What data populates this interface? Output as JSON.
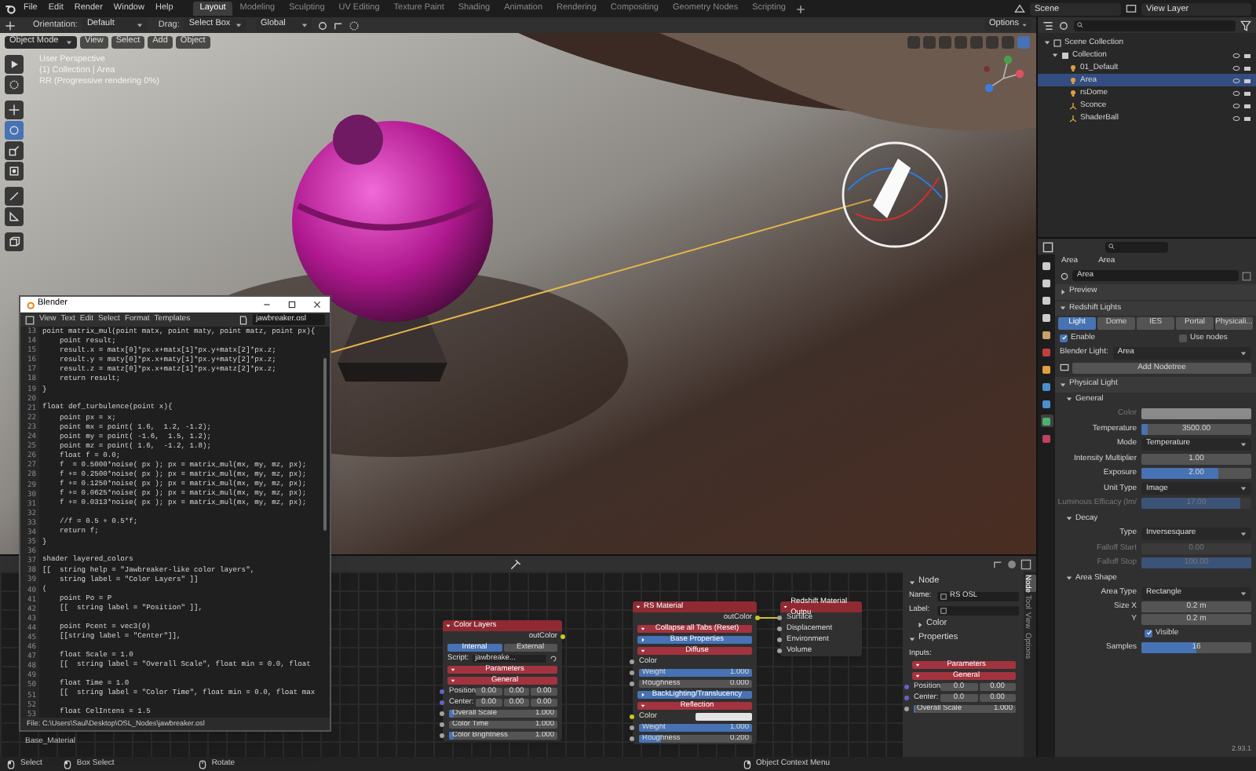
{
  "menubar": {
    "menus": [
      "File",
      "Edit",
      "Render",
      "Window",
      "Help"
    ],
    "workspaces": [
      {
        "label": "Layout",
        "selected": true
      },
      {
        "label": "Modeling",
        "selected": false
      },
      {
        "label": "Sculpting",
        "selected": false
      },
      {
        "label": "UV Editing",
        "selected": false
      },
      {
        "label": "Texture Paint",
        "selected": false
      },
      {
        "label": "Shading",
        "selected": false
      },
      {
        "label": "Animation",
        "selected": false
      },
      {
        "label": "Rendering",
        "selected": false
      },
      {
        "label": "Compositing",
        "selected": false
      },
      {
        "label": "Geometry Nodes",
        "selected": false
      },
      {
        "label": "Scripting",
        "selected": false
      }
    ],
    "scene": "Scene",
    "view_layer": "View Layer"
  },
  "tool_header": {
    "orientation_label": "Orientation:",
    "orientation": "Default",
    "drag_label": "Drag:",
    "drag": "Select Box",
    "transform": "Global",
    "options": "Options"
  },
  "viewport": {
    "mode": "Object Mode",
    "menus": [
      "View",
      "Select",
      "Add",
      "Object"
    ],
    "overlay_lines": [
      "User Perspective",
      "(1) Collection | Area",
      "RR (Progressive rendering 0%)"
    ],
    "tools": [
      {
        "kind": "select",
        "selected": false
      },
      {
        "kind": "cursor",
        "selected": false
      },
      {
        "kind": "move",
        "selected": false
      },
      {
        "kind": "rotate",
        "selected": true
      },
      {
        "kind": "scale",
        "selected": false
      },
      {
        "kind": "transform",
        "selected": false
      },
      {
        "kind": "annotate",
        "selected": false
      },
      {
        "kind": "measure",
        "selected": false
      },
      {
        "kind": "add-cube",
        "selected": false
      }
    ]
  },
  "text_editor": {
    "title": "Blender",
    "menus": [
      "View",
      "Text",
      "Edit",
      "Select",
      "Format",
      "Templates"
    ],
    "file": "jawbreaker.osl",
    "lines": [
      {
        "number": "13",
        "code": "point matrix_mul(point matx, point maty, point matz, point px){"
      },
      {
        "number": "14",
        "code": "    point result;"
      },
      {
        "number": "15",
        "code": "    result.x = matx[0]*px.x+matx[1]*px.y+matx[2]*px.z;"
      },
      {
        "number": "16",
        "code": "    result.y = maty[0]*px.x+maty[1]*px.y+maty[2]*px.z;"
      },
      {
        "number": "17",
        "code": "    result.z = matz[0]*px.x+matz[1]*px.y+matz[2]*px.z;"
      },
      {
        "number": "18",
        "code": "    return result;"
      },
      {
        "number": "19",
        "code": "}"
      },
      {
        "number": "20"
      },
      {
        "number": "21",
        "code": "float def_turbulence(point x){"
      },
      {
        "number": "22",
        "code": "    point px = x;"
      },
      {
        "number": "23",
        "code": "    point mx = point( 1.6,  1.2, -1.2);"
      },
      {
        "number": "24",
        "code": "    point my = point( -1.6,  1.5, 1.2);"
      },
      {
        "number": "25",
        "code": "    point mz = point( 1.6,  -1.2, 1.8);"
      },
      {
        "number": "26",
        "code": "    float f = 0.0;"
      },
      {
        "number": "27",
        "code": "    f  = 0.5000*noise( px ); px = matrix_mul(mx, my, mz, px);"
      },
      {
        "number": "28",
        "code": "    f += 0.2500*noise( px ); px = matrix_mul(mx, my, mz, px);"
      },
      {
        "number": "29",
        "code": "    f += 0.1250*noise( px ); px = matrix_mul(mx, my, mz, px);"
      },
      {
        "number": "30",
        "code": "    f += 0.0625*noise( px ); px = matrix_mul(mx, my, mz, px);"
      },
      {
        "number": "31",
        "code": "    f += 0.0313*noise( px ); px = matrix_mul(mx, my, mz, px);"
      },
      {
        "number": "32"
      },
      {
        "number": "33",
        "code": "    //f = 0.5 + 0.5*f;"
      },
      {
        "number": "34",
        "code": "    return f;"
      },
      {
        "number": "35",
        "code": "}"
      },
      {
        "number": "36"
      },
      {
        "number": "37",
        "code": "shader layered_colors"
      },
      {
        "number": "38",
        "code": "[[  string help = \"Jawbreaker-like color layers\","
      },
      {
        "number": "39",
        "code": "    string label = \"Color Layers\" ]]"
      },
      {
        "number": "40",
        "code": "("
      },
      {
        "number": "41",
        "code": "    point Po = P"
      },
      {
        "number": "42",
        "code": "    [[  string label = \"Position\" ]],"
      },
      {
        "number": "43"
      },
      {
        "number": "44",
        "code": "    point Pcent = vec3(0)"
      },
      {
        "number": "45",
        "code": "    [[string label = \"Center\"]],"
      },
      {
        "number": "46"
      },
      {
        "number": "47",
        "code": "    float Scale = 1.0"
      },
      {
        "number": "48",
        "code": "    [[  string label = \"Overall Scale\", float min = 0.0, float"
      },
      {
        "number": "49"
      },
      {
        "number": "50",
        "code": "    float Time = 1.0"
      },
      {
        "number": "51",
        "code": "    [[  string label = \"Color Time\", float min = 0.0, float max"
      },
      {
        "number": "52"
      },
      {
        "number": "53",
        "code": "    float CelIntens = 1.5"
      }
    ],
    "footer": "File: C:\\Users\\Saul\\Desktop\\OSL_Nodes\\jawbreaker.osl"
  },
  "node_editor": {
    "material": "Base_Material",
    "nodes": [
      {
        "title": "Color Layers",
        "rows": [
          {
            "kind": "output",
            "label": "outColor"
          },
          {
            "kind": "tabs",
            "tabs": [
              {
                "label": "Internal",
                "selected": true
              },
              {
                "label": "External",
                "selected": false
              }
            ]
          },
          {
            "kind": "script",
            "label": "Script:",
            "value": "jawbreake..."
          },
          {
            "kind": "panel",
            "label": "Parameters",
            "expanded": true
          },
          {
            "kind": "panel",
            "label": "General",
            "expanded": true
          },
          {
            "kind": "vector",
            "label": "Position:",
            "values": [
              "0.00",
              "0.00",
              "0.00"
            ]
          },
          {
            "kind": "vector",
            "label": "Center:",
            "values": [
              "0.00",
              "0.00",
              "0.00"
            ]
          },
          {
            "kind": "value",
            "label": "Overall Scale",
            "value": "1.000",
            "level": 0.05
          },
          {
            "kind": "value",
            "label": "Color Time",
            "value": "1.000",
            "level": 0
          },
          {
            "kind": "value",
            "label": "Color Brightness",
            "value": "1.000",
            "level": 0.05
          }
        ]
      },
      {
        "title": "RS Material",
        "rows": [
          {
            "kind": "output",
            "label": "outColor"
          },
          {
            "kind": "panel",
            "label": "Collapse all Tabs (Reset)",
            "expanded": true
          },
          {
            "kind": "section",
            "label": "Base Properties",
            "expanded": false
          },
          {
            "kind": "panel",
            "label": "Diffuse",
            "expanded": true
          },
          {
            "kind": "input",
            "label": "Color"
          },
          {
            "kind": "value",
            "label": "Weight",
            "value": "1.000",
            "level": 1
          },
          {
            "kind": "value",
            "label": "Roughness",
            "value": "0.000",
            "level": 0
          },
          {
            "kind": "section",
            "label": "BackLighting/Translucency",
            "expanded": false
          },
          {
            "kind": "panel",
            "label": "Reflection",
            "expanded": true
          },
          {
            "kind": "color",
            "label": "Color",
            "color": "#e4e4e4"
          },
          {
            "kind": "value",
            "label": "Weight",
            "value": "1.000",
            "level": 1
          },
          {
            "kind": "value",
            "label": "Roughness",
            "value": "0.200",
            "level": 0.2
          }
        ]
      },
      {
        "title": "Redshift Material Outpu",
        "rows": [
          {
            "kind": "input",
            "label": "Surface"
          },
          {
            "kind": "input",
            "label": "Displacement"
          },
          {
            "kind": "input",
            "label": "Environment"
          },
          {
            "kind": "input",
            "label": "Volume"
          }
        ]
      }
    ],
    "sidebar": {
      "tabs": [
        {
          "label": "Node",
          "selected": true
        },
        {
          "label": "Tool",
          "selected": false
        },
        {
          "label": "View",
          "selected": false
        },
        {
          "label": "Options",
          "selected": false
        }
      ],
      "rows": [
        {
          "kind": "header",
          "label": "Node",
          "expanded": true
        },
        {
          "kind": "field",
          "label": "Name:",
          "value": "RS OSL"
        },
        {
          "kind": "field",
          "label": "Label:"
        },
        {
          "kind": "subheader",
          "label": "Color",
          "expanded": false
        },
        {
          "kind": "header",
          "label": "Properties",
          "expanded": true
        },
        {
          "kind": "text",
          "label": "Inputs:"
        },
        {
          "kind": "panel",
          "label": "Parameters",
          "expanded": true
        },
        {
          "kind": "panel",
          "label": "General",
          "expanded": true
        },
        {
          "kind": "vector",
          "label": "Position:",
          "values": [
            "0.0",
            "0.00"
          ]
        },
        {
          "kind": "vector",
          "label": "Center:",
          "values": [
            "0.0",
            "0.00"
          ]
        },
        {
          "kind": "value",
          "label": "Overall Scale",
          "value": "1.000",
          "level": 0.02
        }
      ]
    }
  },
  "outliner": {
    "items": [
      {
        "label": "Scene Collection",
        "kind": "scene",
        "selected": false,
        "expanded": true,
        "children": [
          {
            "label": "Collection",
            "kind": "collection",
            "selected": false,
            "expanded": true,
            "children": [
              {
                "label": "01_Default",
                "kind": "light",
                "selected": false
              },
              {
                "label": "Area",
                "kind": "light",
                "selected": true
              },
              {
                "label": "rsDome",
                "kind": "light",
                "selected": false
              },
              {
                "label": "Sconce",
                "kind": "mesh",
                "selected": false
              },
              {
                "label": "ShaderBall",
                "kind": "mesh",
                "selected": false
              }
            ]
          }
        ]
      }
    ]
  },
  "properties": {
    "tabs": [
      {
        "kind": "tool",
        "selected": false
      },
      {
        "kind": "render",
        "selected": false
      },
      {
        "kind": "output",
        "selected": false
      },
      {
        "kind": "view-layer",
        "selected": false
      },
      {
        "kind": "scene",
        "selected": false
      },
      {
        "kind": "world",
        "selected": false
      },
      {
        "kind": "object",
        "selected": false
      },
      {
        "kind": "physics",
        "selected": false
      },
      {
        "kind": "constraints",
        "selected": false
      },
      {
        "kind": "data",
        "selected": true
      },
      {
        "kind": "material",
        "selected": false
      }
    ],
    "breadcrumb": [
      "Area",
      "Area"
    ],
    "datablock": "Area",
    "rows": [
      {
        "kind": "panel",
        "label": "Preview",
        "expanded": false
      },
      {
        "kind": "panel",
        "label": "Redshift Lights",
        "expanded": true
      },
      {
        "kind": "tabs",
        "tabs": [
          {
            "label": "Light",
            "selected": true
          },
          {
            "label": "Dome",
            "selected": false
          },
          {
            "label": "IES",
            "selected": false
          },
          {
            "label": "Portal",
            "selected": false
          },
          {
            "label": "Physicali...",
            "selected": false
          }
        ]
      },
      {
        "kind": "checks",
        "checks": [
          {
            "label": "Enable",
            "checked": true
          },
          {
            "label": "Use nodes",
            "checked": false
          }
        ]
      },
      {
        "kind": "inline-dropdown",
        "label": "Blender Light:",
        "value": "Area"
      },
      {
        "kind": "button",
        "label": "Add Nodetree"
      },
      {
        "kind": "panel",
        "label": "Physical Light",
        "expanded": true
      },
      {
        "kind": "subpanel",
        "label": "General",
        "expanded": true
      },
      {
        "kind": "color",
        "label": "Color",
        "disabled": true
      },
      {
        "kind": "slider",
        "label": "Temperature",
        "value": "3500.00",
        "level": 0.06,
        "disabled": false
      },
      {
        "kind": "dropdown",
        "label": "Mode",
        "value": "Temperature"
      },
      {
        "kind": "slider",
        "label": "Intensity Multiplier",
        "value": "1.00",
        "level": 0,
        "disabled": false
      },
      {
        "kind": "slider",
        "label": "Exposure",
        "value": "2.00",
        "level": 0.7,
        "disabled": false
      },
      {
        "kind": "dropdown",
        "label": "Unit Type",
        "value": "Image"
      },
      {
        "kind": "slider",
        "label": "Luminous Efficacy (lm/",
        "value": "17.00",
        "level": 0.9,
        "disabled": true
      },
      {
        "kind": "subpanel",
        "label": "Decay",
        "expanded": true
      },
      {
        "kind": "dropdown",
        "label": "Type",
        "value": "Inversesquare"
      },
      {
        "kind": "slider",
        "label": "Falloff Start",
        "value": "0.00",
        "level": 0,
        "disabled": true
      },
      {
        "kind": "slider",
        "label": "Falloff Stop",
        "value": "100.00",
        "level": 1,
        "disabled": true
      },
      {
        "kind": "subpanel",
        "label": "Area Shape",
        "expanded": true
      },
      {
        "kind": "dropdown",
        "label": "Area Type",
        "value": "Rectangle"
      },
      {
        "kind": "field",
        "label": "Size X",
        "value": "0.2 m"
      },
      {
        "kind": "field",
        "label": "Y",
        "value": "0.2 m"
      },
      {
        "kind": "check",
        "label": "Visible",
        "checked": true
      },
      {
        "kind": "slider",
        "label": "Samples",
        "value": "16",
        "level": 0.5,
        "disabled": false
      }
    ],
    "version": "2.93.1"
  },
  "status_bar": {
    "items": [
      {
        "kind": "left",
        "label": "Select"
      },
      {
        "kind": "left-drag",
        "label": "Box Select"
      },
      {
        "kind": "middle",
        "label": "Rotate"
      },
      {
        "kind": "right",
        "label": "Object Context Menu"
      }
    ]
  }
}
